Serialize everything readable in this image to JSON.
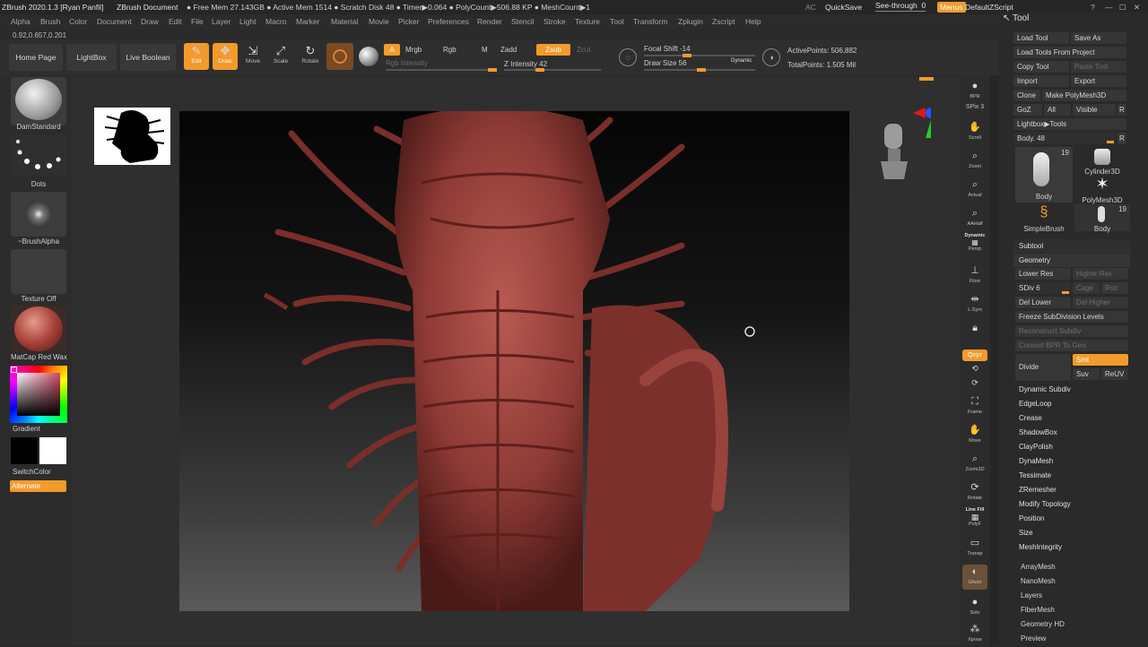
{
  "titlebar": {
    "app": "ZBrush 2020.1.3 [Ryan Panfil]",
    "document": "ZBrush Document",
    "stats": "● Free Mem 27.143GB ● Active Mem 1514 ● Scratch Disk 48 ● Timer▶0.064 ● PolyCount▶506.88 KP ● MeshCount▶1",
    "ac": "AC",
    "quicksave": "QuickSave",
    "seethrough": "See-through",
    "seethrough_value": "0",
    "menus": "Menus",
    "script": "DefaultZScript",
    "window_controls": [
      "?",
      "—",
      "☐",
      "✕"
    ]
  },
  "menubar": [
    "Alpha",
    "Brush",
    "Color",
    "Document",
    "Draw",
    "Edit",
    "File",
    "Layer",
    "Light",
    "Macro",
    "Marker",
    "Material",
    "Movie",
    "Picker",
    "Preferences",
    "Render",
    "Stencil",
    "Stroke",
    "Texture",
    "Tool",
    "Transform",
    "Zplugin",
    "Zscript",
    "Help"
  ],
  "coords": "0.92,0.657,0.201",
  "topshelf": {
    "home": "Home Page",
    "lightbox": "LightBox",
    "live_boolean": "Live Boolean",
    "edit": "Edit",
    "draw": "Draw",
    "move": "Move",
    "scale": "Scale",
    "rotate": "Rotate",
    "a": "A",
    "mrgb": "Mrgb",
    "rgb": "Rgb",
    "m": "M",
    "zadd": "Zadd",
    "zsub": "Zsub",
    "zcut": "Zcut",
    "rgb_intensity": "Rgb Intensity",
    "z_intensity": "Z Intensity 42",
    "focal_shift": "Focal Shift -14",
    "draw_size": "Draw Size 56",
    "dynamic": "Dynamic",
    "active_points": "ActivePoints: 506,882",
    "total_points": "TotalPoints: 1.505 Mil",
    "z_intensity_level": 0.42,
    "focal_shift_level": 0.43,
    "draw_size_level": 0.56
  },
  "leftshelf": {
    "brush": "DamStandard",
    "stroke": "Dots",
    "alpha": "~BrushAlpha",
    "texture": "Texture Off",
    "material": "MatCap Red Wax",
    "gradient": "Gradient",
    "switchcolor": "SwitchColor",
    "alternate": "Alternate"
  },
  "rightshelf": [
    "BPR",
    "SPix 3",
    "Scroll",
    "Zoom",
    "Actual",
    "AAHalf",
    "Persp",
    "Floor",
    "L.Sym",
    "",
    "Qxyz",
    "",
    "",
    "Frame",
    "Move",
    "Zoom3D",
    "Rotate",
    "PolyF",
    "Transp",
    "Ghost",
    "Solo",
    "Xpose"
  ],
  "rightshelf_extra": {
    "dynamic": "Dynamic",
    "line_fill": "Line Fill"
  },
  "toolpanel": {
    "title": "Tool",
    "load_tool": "Load Tool",
    "save_as": "Save As",
    "load_from_project": "Load Tools From Project",
    "copy_tool": "Copy Tool",
    "paste_tool": "Paste Tool",
    "import": "Import",
    "export": "Export",
    "clone": "Clone",
    "make_polymesh": "Make PolyMesh3D",
    "goz": "GoZ",
    "all": "All",
    "visible": "Visible",
    "r": "R",
    "lightbox_tools": "Lightbox▶Tools",
    "body_slider": "Body. 48",
    "thumbs": [
      {
        "label": "Body",
        "count": "19"
      },
      {
        "label": "Cylinder3D",
        "count": ""
      },
      {
        "label": "PolyMesh3D",
        "count": ""
      },
      {
        "label": "SimpleBrush",
        "count": ""
      },
      {
        "label": "Body",
        "count": "19"
      }
    ],
    "subtool": "Subtool",
    "geometry": "Geometry",
    "lower_res": "Lower Res",
    "higher_res": "Higher Res",
    "sdiv": "SDiv 6",
    "cage": "Cage",
    "rstr": "Rstr",
    "del_lower": "Del Lower",
    "del_higher": "Del Higher",
    "freeze": "Freeze SubDivision Levels",
    "reconstruct": "Reconstruct Subdiv",
    "convert_bpr": "Convert BPR To Geo",
    "divide": "Divide",
    "smt": "Smt",
    "suv": "Suv",
    "reuv": "ReUV",
    "geometry_items": [
      "Dynamic Subdiv",
      "EdgeLoop",
      "Crease",
      "ShadowBox",
      "ClayPolish",
      "DynaMesh",
      "Tessimate",
      "ZRemesher",
      "Modify Topology",
      "Position",
      "Size",
      "MeshIntegrity"
    ],
    "bottom_items": [
      "ArrayMesh",
      "NanoMesh",
      "Layers",
      "FiberMesh",
      "Geometry HD",
      "Preview"
    ]
  },
  "colors": {
    "accent": "#f39a2c",
    "model": "#8e3a35"
  }
}
